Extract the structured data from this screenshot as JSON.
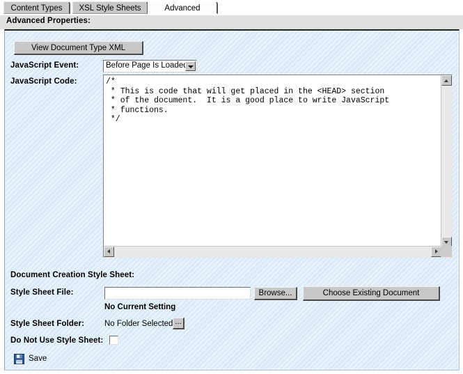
{
  "tabs": [
    {
      "label": "Content Types",
      "active": false
    },
    {
      "label": "XSL Style Sheets",
      "active": false
    },
    {
      "label": "Advanced",
      "active": true
    }
  ],
  "page_title": "Advanced Properties:",
  "toolbar": {
    "view_xml_label": "View Document Type XML"
  },
  "javascript_event": {
    "label": "JavaScript Event:",
    "selected": "Before Page Is Loaded"
  },
  "javascript_code": {
    "label": "JavaScript Code:",
    "value": "/*\n * This is code that will get placed in the <HEAD> section\n * of the document.  It is a good place to write JavaScript\n * functions.\n */"
  },
  "document_creation_style_sheet": {
    "heading": "Document Creation Style Sheet:",
    "style_sheet_file": {
      "label": "Style Sheet File:",
      "value": "",
      "placeholder": "",
      "browse_label": "Browse...",
      "choose_existing_label": "Choose Existing Document",
      "current_setting": "No Current Setting"
    },
    "style_sheet_folder": {
      "label": "Style Sheet Folder:",
      "value": "No Folder Selected",
      "browse_label": "..."
    },
    "do_not_use_style_sheet": {
      "label": "Do Not Use Style Sheet:",
      "checked": false
    }
  },
  "save": {
    "label": "Save",
    "icon": "floppy-disk-icon"
  },
  "icons": {
    "dropdown_arrow": "chevron-down-icon",
    "scroll_up": "scroll-up-arrow-icon",
    "scroll_down": "scroll-down-arrow-icon",
    "scroll_left": "scroll-left-arrow-icon",
    "scroll_right": "scroll-right-arrow-icon"
  },
  "colors": {
    "panel_background": "#dbeaf8",
    "header_band": "#e0e0e0",
    "button_face": "#c8c8c8",
    "active_tab": "#fdfdfd",
    "inactive_tab": "#c8c8c8",
    "save_icon_blue": "#2a5ca8"
  }
}
